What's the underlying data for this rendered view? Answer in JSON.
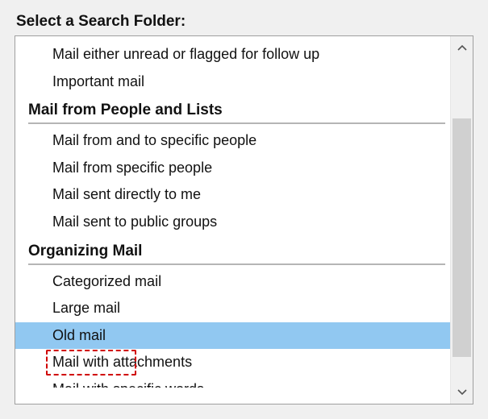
{
  "title": "Select a Search Folder:",
  "groups": {
    "reading": {
      "items": [
        "Mail either unread or flagged for follow up",
        "Important mail"
      ]
    },
    "people": {
      "header": "Mail from People and Lists",
      "items": [
        "Mail from and to specific people",
        "Mail from specific people",
        "Mail sent directly to me",
        "Mail sent to public groups"
      ]
    },
    "organizing": {
      "header": "Organizing Mail",
      "items": [
        "Categorized mail",
        "Large mail",
        "Old mail",
        "Mail with attachments",
        "Mail with specific words"
      ]
    }
  },
  "selected_item": "Old mail",
  "colors": {
    "selection": "#91c8f1",
    "highlight_border": "#d00000",
    "panel_bg": "#ffffff",
    "page_bg": "#f0f0f0"
  }
}
